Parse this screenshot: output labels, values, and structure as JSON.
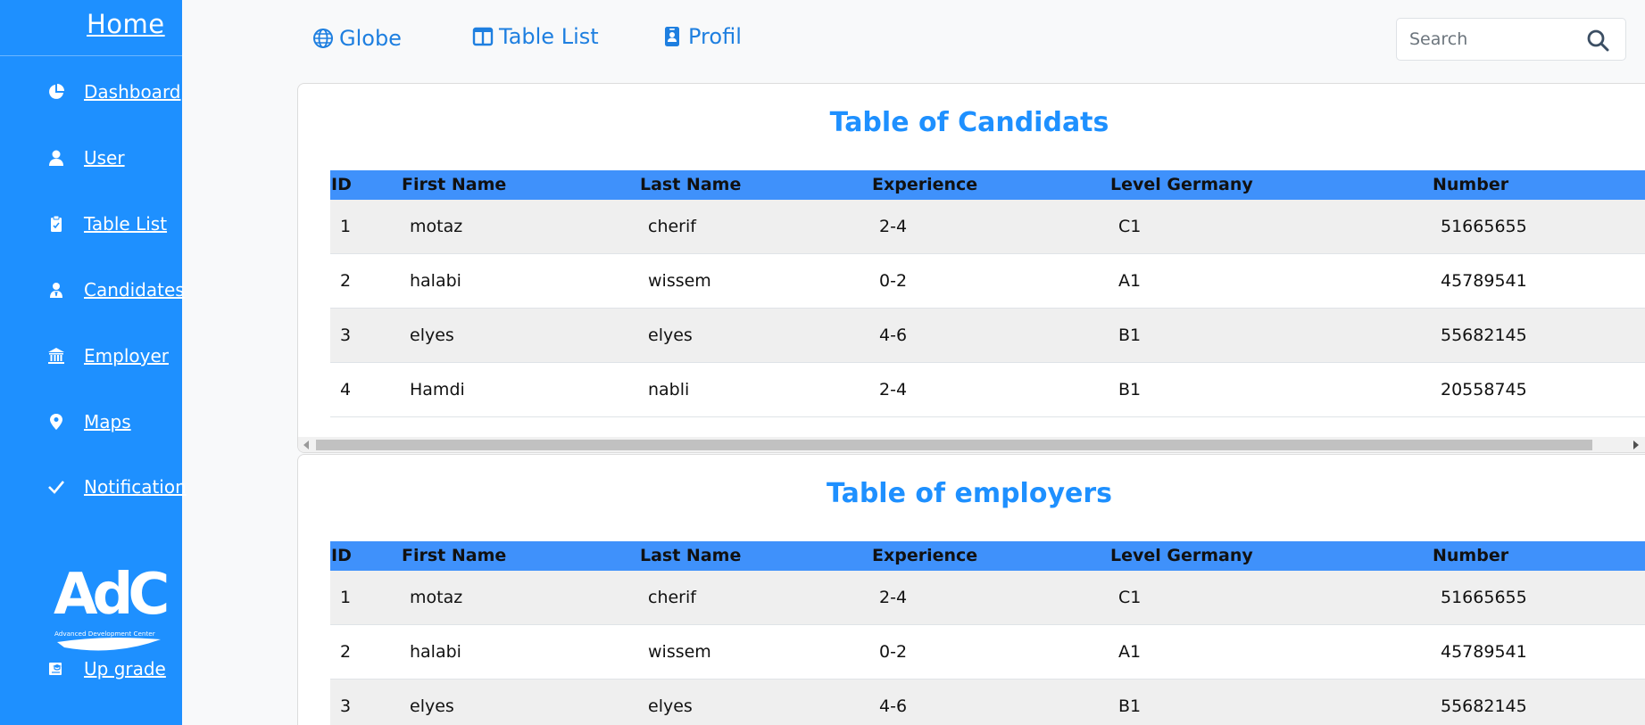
{
  "sidebar": {
    "home_label": "Home",
    "items": [
      {
        "label": "Dashboard",
        "icon": "pie-chart-icon"
      },
      {
        "label": "User",
        "icon": "user-icon"
      },
      {
        "label": "Table List",
        "icon": "clipboard-icon"
      },
      {
        "label": "Candidates",
        "icon": "users-icon"
      },
      {
        "label": "Employer",
        "icon": "bank-icon"
      },
      {
        "label": "Maps",
        "icon": "map-pin-icon"
      },
      {
        "label": "Notification",
        "icon": "check-icon"
      }
    ],
    "logo_text": "AdC",
    "logo_subtitle": "Advanced Development Center",
    "upgrade_label": "Up grade",
    "colors": {
      "background": "#1e90ff",
      "text": "#ffffff"
    }
  },
  "topbar": {
    "items": [
      {
        "label": "Globe",
        "icon": "globe-icon"
      },
      {
        "label": "Table List",
        "icon": "table-icon"
      },
      {
        "label": "Profil",
        "icon": "badge-icon"
      }
    ],
    "search": {
      "placeholder": "Search",
      "icon": "search-icon"
    },
    "colors": {
      "link": "#1e7fe0"
    }
  },
  "candidates_table": {
    "title": "Table of Candidats",
    "columns": [
      "ID",
      "First Name",
      "Last Name",
      "Experience",
      "Level Germany",
      "Number"
    ],
    "rows": [
      [
        "1",
        "motaz",
        "cherif",
        "2-4",
        "C1",
        "51665655"
      ],
      [
        "2",
        "halabi",
        "wissem",
        "0-2",
        "A1",
        "45789541"
      ],
      [
        "3",
        "elyes",
        "elyes",
        "4-6",
        "B1",
        "55682145"
      ],
      [
        "4",
        "Hamdi",
        "nabli",
        "2-4",
        "B1",
        "20558745"
      ]
    ]
  },
  "employers_table": {
    "title": "Table of employers",
    "columns": [
      "ID",
      "First Name",
      "Last Name",
      "Experience",
      "Level Germany",
      "Number"
    ],
    "rows": [
      [
        "1",
        "motaz",
        "cherif",
        "2-4",
        "C1",
        "51665655"
      ],
      [
        "2",
        "halabi",
        "wissem",
        "0-2",
        "A1",
        "45789541"
      ],
      [
        "3",
        "elyes",
        "elyes",
        "4-6",
        "B1",
        "55682145"
      ]
    ]
  },
  "colors": {
    "accent": "#1e90ff",
    "table_header": "#3f91fb",
    "page_bg": "#f8f9fa"
  }
}
